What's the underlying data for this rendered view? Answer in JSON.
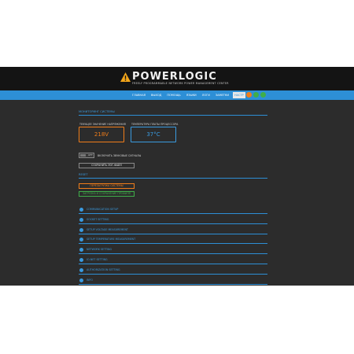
{
  "header": {
    "brand": "POWERLOGIC",
    "tagline": "FREELY PROGRAMMABLE NETWORK POWER MANAGEMENT CENTER"
  },
  "nav": {
    "items": [
      "ГЛАВНАЯ",
      "ВЫХОД",
      "ПОМОЩЬ",
      "ЯЗЫКИ",
      "ЛОГИ",
      "ЗАМЕТКИ",
      "НАСТР"
    ],
    "active_index": 6
  },
  "lang_colors": [
    "#f07d1a",
    "#3fae49",
    "#3fae49"
  ],
  "monitoring": {
    "title": "МОНИТОРИНГ СИСТЕМЫ",
    "voltage_label": "ТЕКУЩЕЕ ЗНАЧЕНИЕ НАПРЯЖЕНИЯ",
    "voltage_value": "218V",
    "voltage_color": "#f07d1a",
    "temp_label": "ТЕМПЕРАТУРА ПЛАТЫ ПРОЦЕССОРА",
    "temp_value": "37°C",
    "temp_color": "#3a9be0"
  },
  "toggle": {
    "state_label": "OFF",
    "label": "ВКЛЮЧИТЬ ЗВУКОВЫЕ СИГНАЛЫ"
  },
  "save_button": "СОХРАНИТЬ ЛОГ-ФАЙЛ",
  "reset": {
    "title": "RESET",
    "reboot_button": "ПЕРЕЗАГРУЗКА СИСТЕМЫ",
    "reboot_color": "#f07d1a",
    "reload_button": "ЗАГРУЗКА И СОХРАНЕНИЕ ПРОФИЛЯ",
    "reload_color": "#3fae49"
  },
  "accordion": [
    "COMMUNICATION SETUP",
    "SOCKET SETTING",
    "SETUP VOLTAGE MEASUREMENT",
    "SETUP TEMPERATURE MEASUREMENT",
    "NETWORK SETTING",
    "IO-NET SETTING",
    "AUTHORIZATION SETTING",
    "INFO"
  ]
}
